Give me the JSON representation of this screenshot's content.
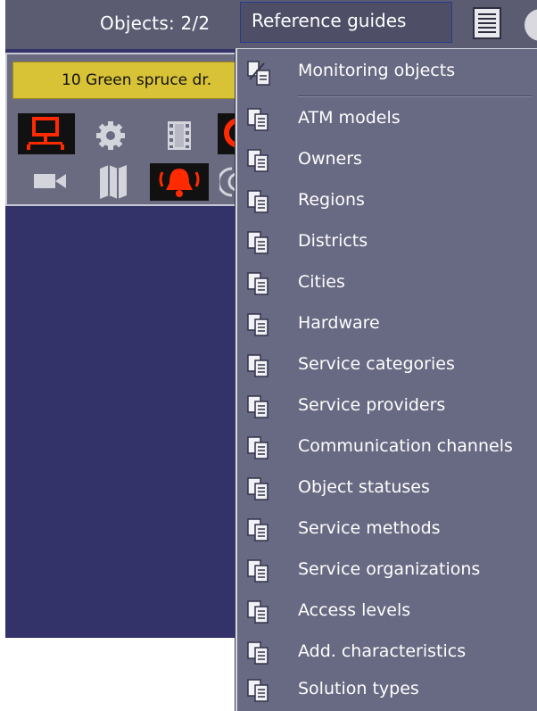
{
  "topbar": {
    "objects_label": "Objects: 2/2",
    "reference_guides_label": "Reference guides"
  },
  "object_card": {
    "address": "10 Green spruce dr."
  },
  "menu": {
    "items": [
      {
        "label": "Monitoring objects",
        "icon": "monitoring-objects-icon"
      },
      {
        "label": "ATM models",
        "icon": "document-icon"
      },
      {
        "label": "Owners",
        "icon": "document-icon"
      },
      {
        "label": "Regions",
        "icon": "document-icon"
      },
      {
        "label": "Districts",
        "icon": "document-icon"
      },
      {
        "label": "Cities",
        "icon": "document-icon"
      },
      {
        "label": "Hardware",
        "icon": "document-icon"
      },
      {
        "label": "Service categories",
        "icon": "document-icon"
      },
      {
        "label": "Service providers",
        "icon": "document-icon"
      },
      {
        "label": "Communication channels",
        "icon": "document-icon"
      },
      {
        "label": "Object statuses",
        "icon": "document-icon"
      },
      {
        "label": "Service methods",
        "icon": "document-icon"
      },
      {
        "label": "Service organizations",
        "icon": "document-icon"
      },
      {
        "label": "Access levels",
        "icon": "document-icon"
      },
      {
        "label": "Add. characteristics",
        "icon": "document-icon"
      },
      {
        "label": "Solution types",
        "icon": "document-icon"
      }
    ]
  },
  "colors": {
    "topbar_bg": "#5b5c72",
    "menu_bg": "#686982",
    "panel_bg": "#33336a",
    "address_bg": "#d8c236",
    "alert_red": "#ff2a00"
  }
}
